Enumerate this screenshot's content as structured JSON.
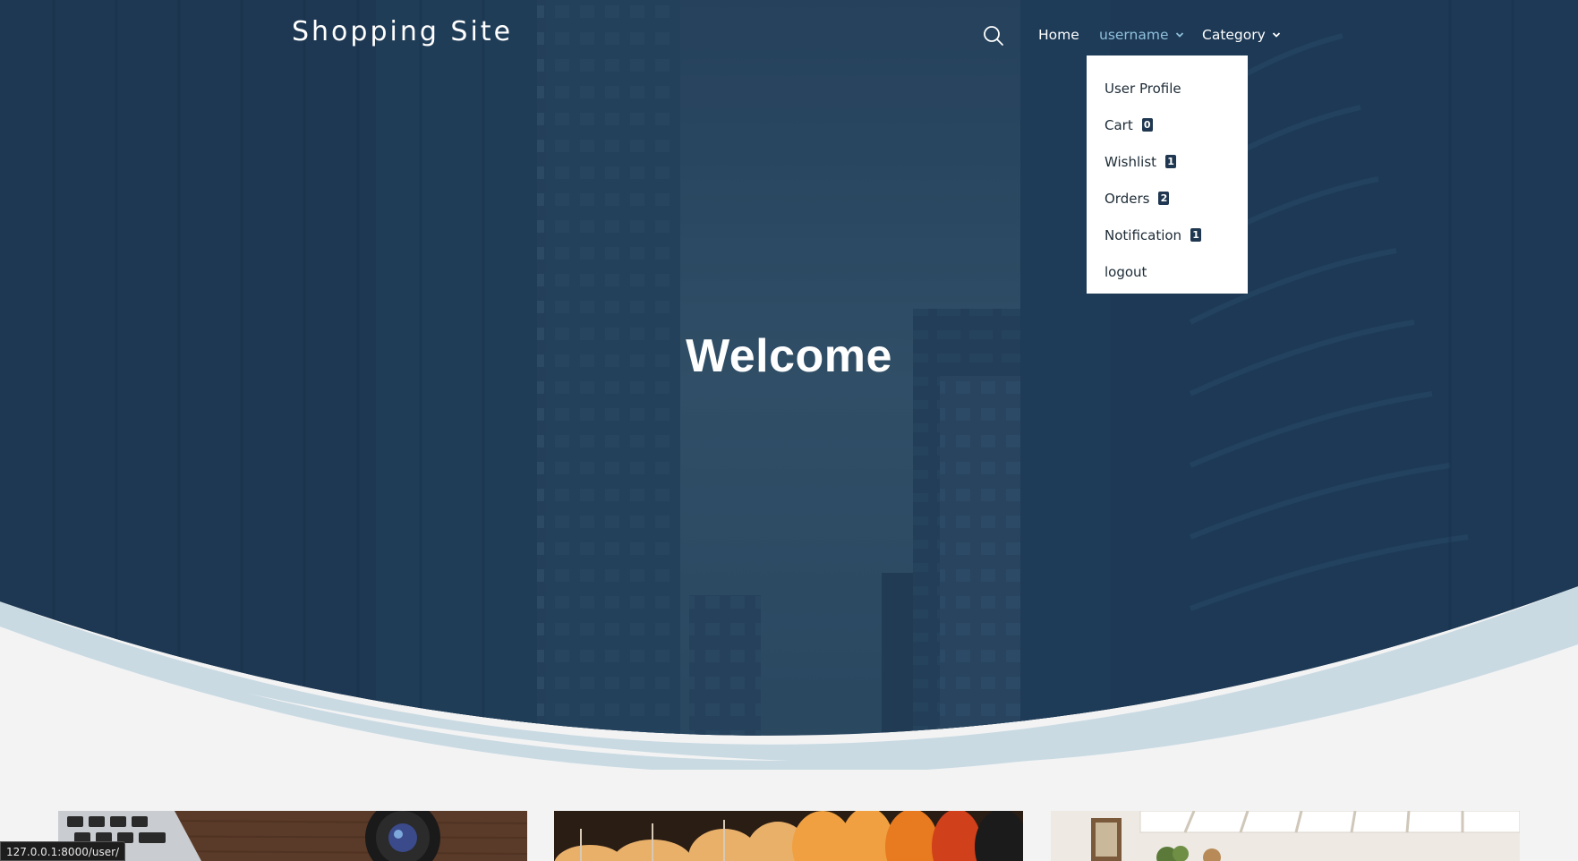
{
  "brand": {
    "title": "Shopping Site"
  },
  "nav": {
    "search_icon": "search-icon",
    "home_label": "Home",
    "username_label": "username",
    "category_label": "Category"
  },
  "user_menu": {
    "items": [
      {
        "label": "User Profile"
      },
      {
        "label": "Cart",
        "badge": "0"
      },
      {
        "label": "Wishlist",
        "badge": "1"
      },
      {
        "label": "Orders",
        "badge": "2"
      },
      {
        "label": "Notification",
        "badge": "1"
      },
      {
        "label": "logout"
      }
    ]
  },
  "hero": {
    "heading": "Welcome",
    "overlay_color": "#1e3a56",
    "wave_color": "#c9dae3"
  },
  "status_bar": {
    "url": "127.0.0.1:8000/user/"
  },
  "colors": {
    "accent_username": "#8fc0dc",
    "badge_bg": "#1f3750",
    "page_bg": "#f3f3f3"
  }
}
